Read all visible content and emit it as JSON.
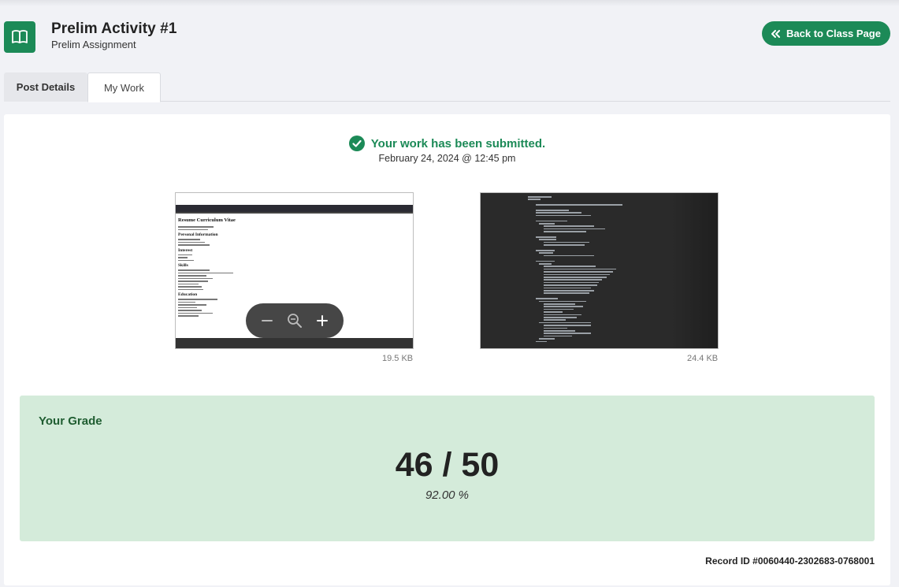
{
  "header": {
    "title": "Prelim Activity #1",
    "subtitle": "Prelim Assignment",
    "back_label": "Back to Class Page",
    "icon": "book-open-icon"
  },
  "tabs": [
    {
      "label": "Post Details",
      "active": false
    },
    {
      "label": "My Work",
      "active": true
    }
  ],
  "submission": {
    "status": "Your work has been submitted.",
    "date": "February 24, 2024 @ 12:45 pm"
  },
  "files": [
    {
      "size": "19.5 KB"
    },
    {
      "size": "24.4 KB"
    }
  ],
  "doc_preview": {
    "heading": "Resume Curriculum Vitae",
    "sections": [
      "Personal Information",
      "Interest",
      "Skills",
      "Education"
    ]
  },
  "grade": {
    "label": "Your Grade",
    "score": "46 / 50",
    "percent": "92.00 %"
  },
  "record": "Record ID #0060440-2302683-0768001",
  "colors": {
    "primary": "#1c8a57",
    "grade_bg": "#d4ebda",
    "grade_label": "#1f5d31"
  }
}
